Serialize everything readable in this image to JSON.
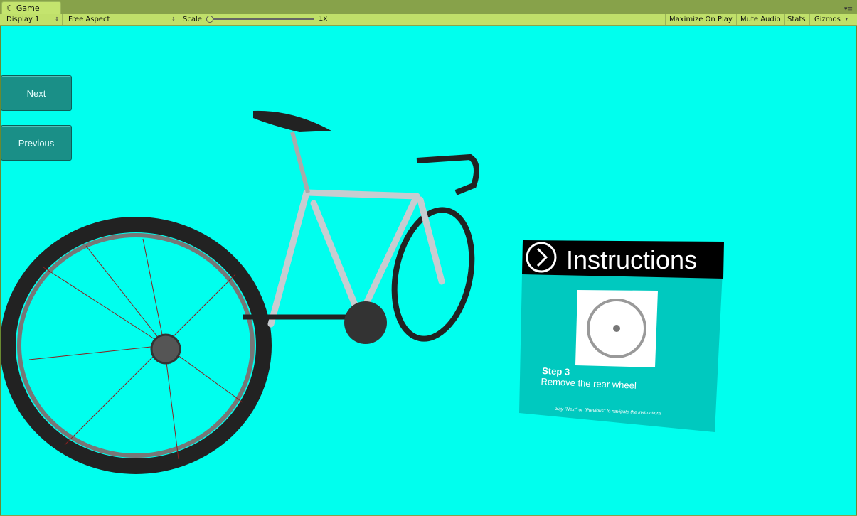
{
  "window": {
    "tab_label": "Game"
  },
  "toolbar": {
    "display": "Display 1",
    "aspect": "Free Aspect",
    "scale_label": "Scale",
    "scale_value": "1x",
    "maximize": "Maximize On Play",
    "mute": "Mute Audio",
    "stats": "Stats",
    "gizmos": "Gizmos"
  },
  "buttons": {
    "next": "Next",
    "previous": "Previous"
  },
  "panel": {
    "title": "Instructions",
    "step": "Step 3",
    "description": "Remove the rear wheel",
    "hint": "Say \"Next\" or \"Previous\" to navigate the instructions"
  },
  "colors": {
    "background": "#00ffee",
    "panel": "#00c9bf",
    "button": "#1a8f87"
  }
}
